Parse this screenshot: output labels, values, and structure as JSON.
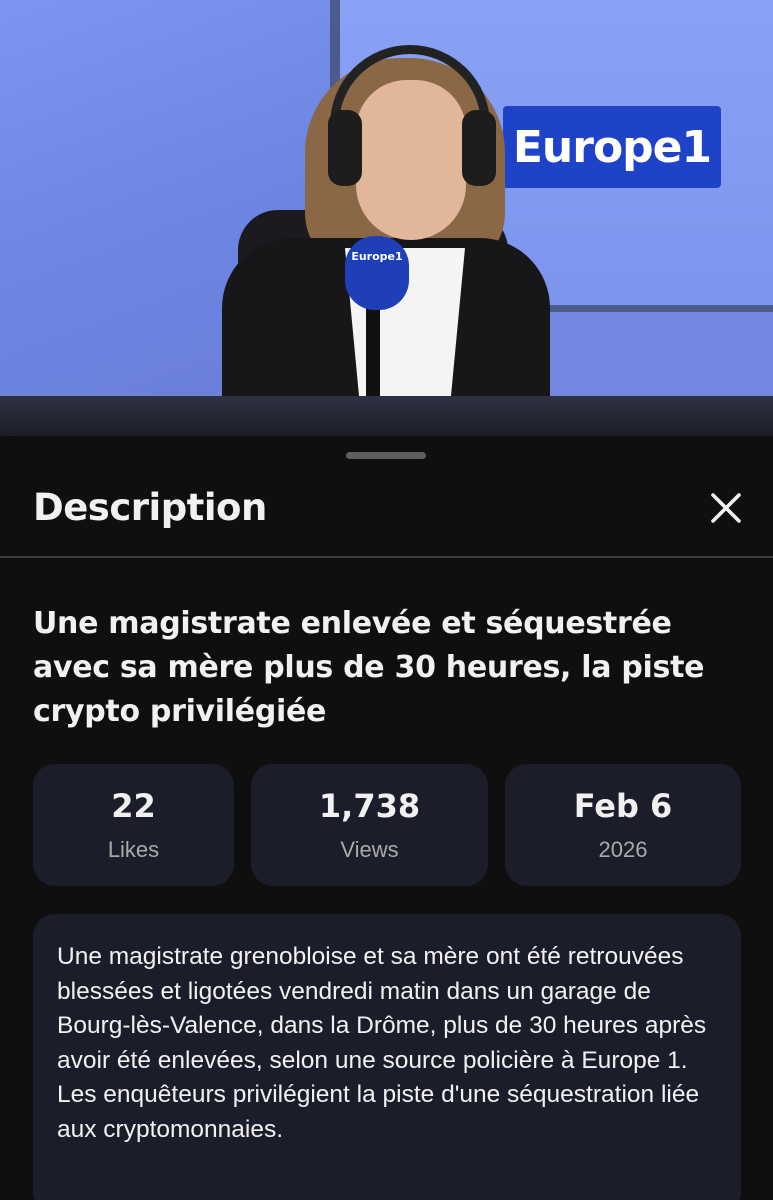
{
  "video": {
    "channel_logo_text": "Europe1",
    "mic_logo_text": "Europe1"
  },
  "sheet": {
    "title": "Description",
    "close_icon": "close-icon",
    "video_title": "Une magistrate enlevée et séquestrée avec sa mère plus de 30 heures, la piste crypto privilégiée",
    "stats": {
      "likes": {
        "value": "22",
        "label": "Likes"
      },
      "views": {
        "value": "1,738",
        "label": "Views"
      },
      "date": {
        "value": "Feb 6",
        "label": "2026"
      }
    },
    "description": "Une magistrate grenobloise et sa mère ont été retrouvées blessées et ligotées vendredi matin dans un garage de Bourg-lès-Valence, dans la Drôme, plus de 30 heures après avoir été enlevées, selon une source policière à Europe 1. Les enquêteurs privilégient la piste d'une séquestration liée aux cryptomonnaies."
  },
  "colors": {
    "sheet_background": "#0f0f0f",
    "card_background": "#1c1d2b",
    "brand_blue": "#1e43c9",
    "secondary_text": "#aaaaaa"
  }
}
